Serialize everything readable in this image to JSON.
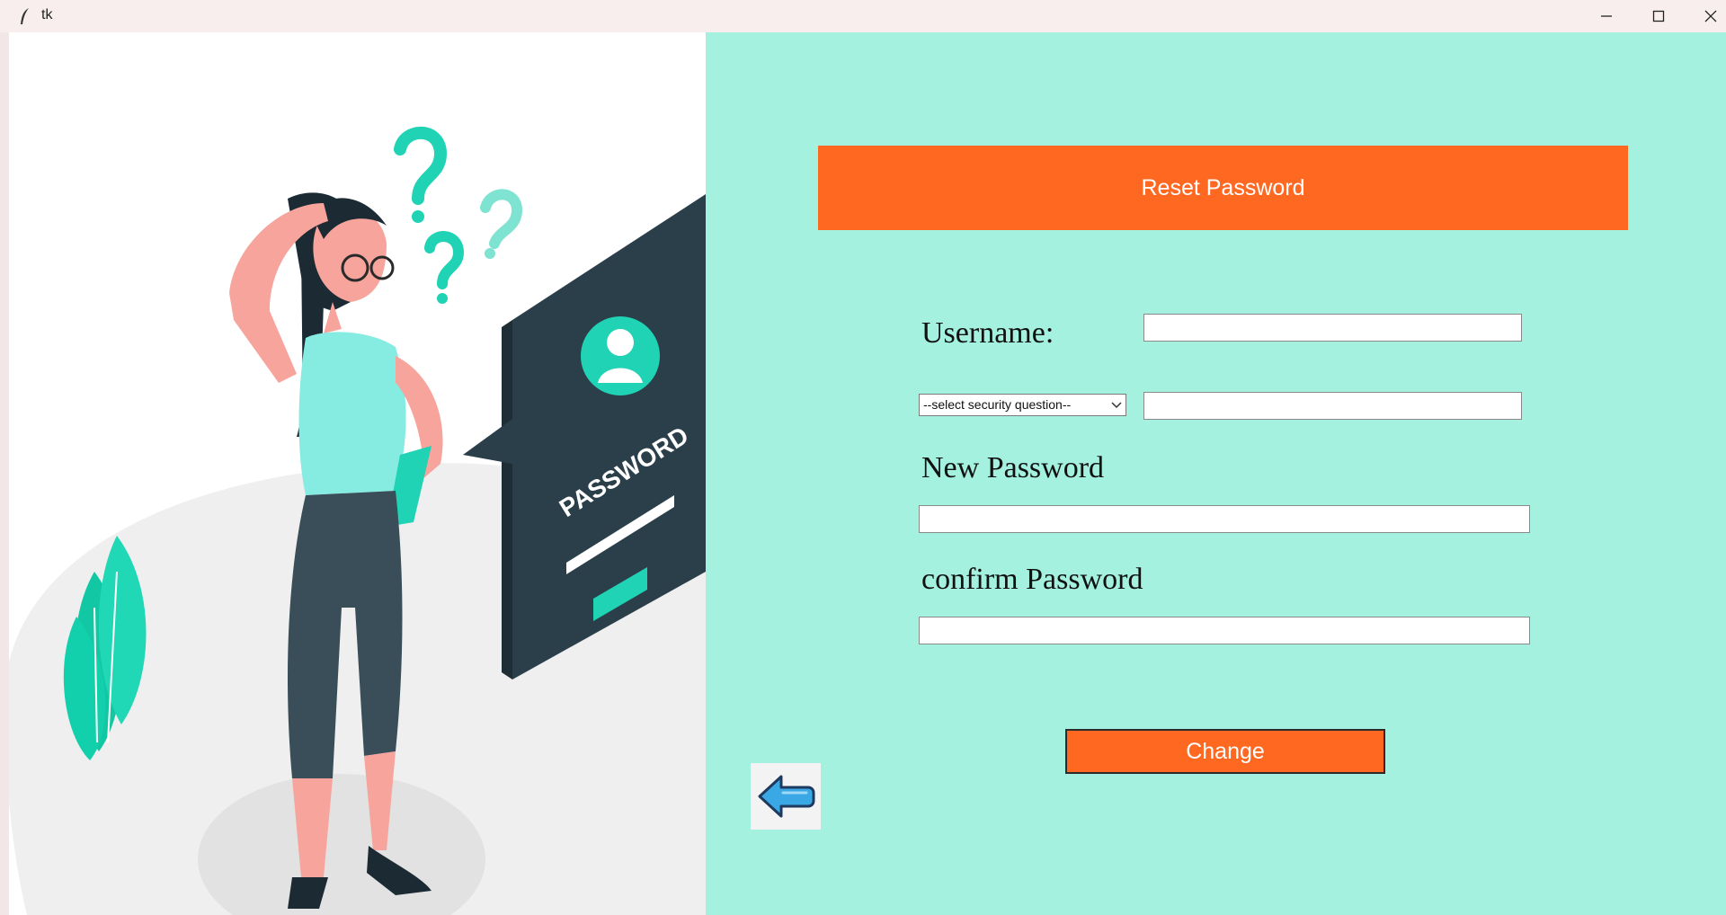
{
  "window": {
    "title": "tk"
  },
  "form": {
    "header": "Reset Password",
    "username_label": "Username:",
    "username_value": "",
    "security_question_selected": "--select security question--",
    "security_answer_value": "",
    "new_password_label": "New Password",
    "new_password_value": "",
    "confirm_password_label": "confirm Password",
    "confirm_password_value": "",
    "change_button": "Change"
  },
  "illustration": {
    "sign_text": "PASSWORD"
  },
  "icons": {
    "app": "feather-icon",
    "minimize": "minimize-icon",
    "maximize": "maximize-icon",
    "close": "close-icon",
    "back": "back-arrow-icon"
  },
  "colors": {
    "panel_background": "#a3f1de",
    "accent_orange": "#fe6821",
    "titlebar": "#f7eeed",
    "teal": "#1fd3b4",
    "dark_slate": "#2b3f4b"
  }
}
